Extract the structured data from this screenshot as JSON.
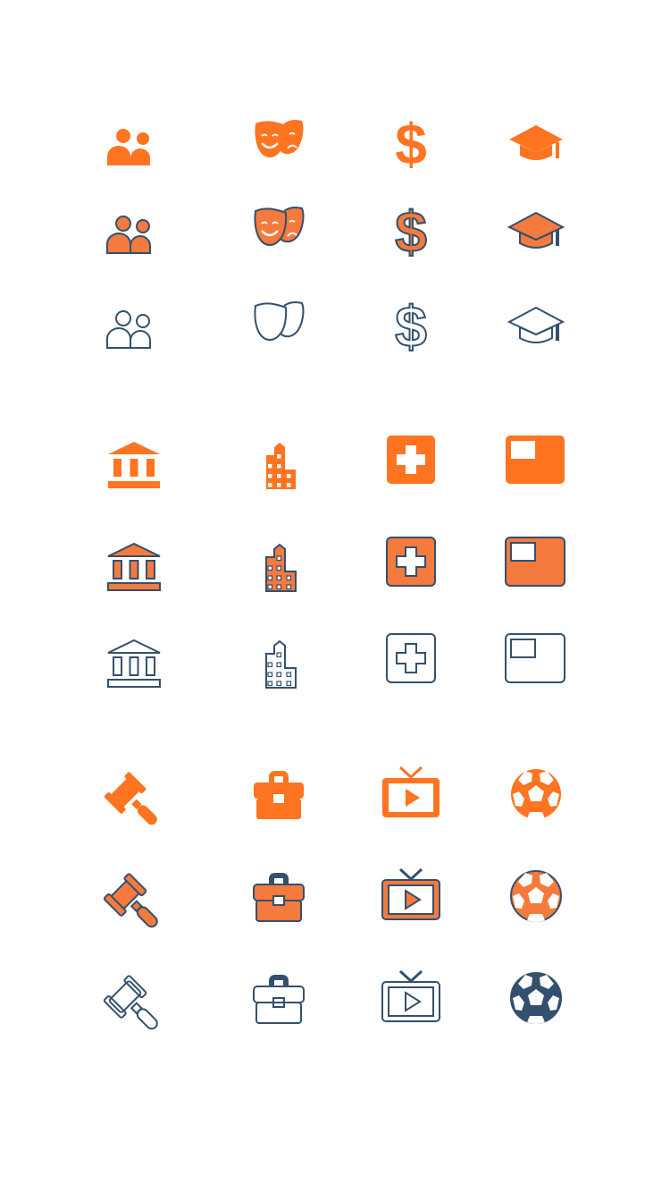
{
  "colors": {
    "accent": "#FF7420",
    "accent_alt": "#F57A3D",
    "stroke": "#34506E",
    "background": "#FFFFFF"
  },
  "icon_set": {
    "styles": [
      "solid",
      "filled-outline",
      "outline"
    ],
    "groups": [
      {
        "icons": [
          "people-icon",
          "theater-masks-icon",
          "dollar-icon",
          "graduation-cap-icon"
        ]
      },
      {
        "icons": [
          "bank-icon",
          "city-buildings-icon",
          "medical-cross-icon",
          "flag-icon"
        ]
      },
      {
        "icons": [
          "gavel-icon",
          "briefcase-icon",
          "tv-play-icon",
          "soccer-ball-icon"
        ]
      }
    ]
  }
}
